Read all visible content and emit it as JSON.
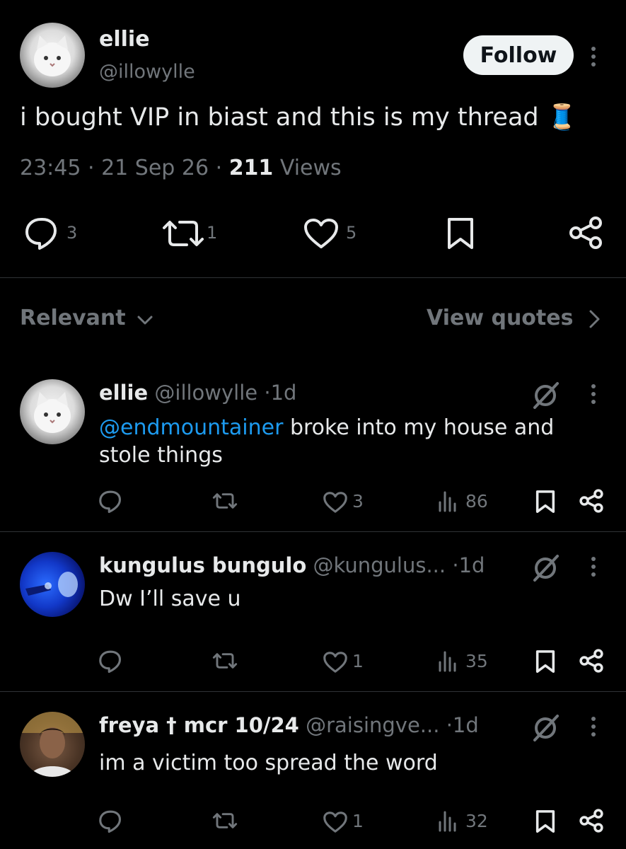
{
  "main_post": {
    "author_name": "ellie",
    "author_handle": "@illowylle",
    "follow_label": "Follow",
    "text": "i bought VIP in biast and this is my thread 🧵",
    "time": "23:45",
    "date": "21 Sep 26",
    "views_count": "211",
    "views_label": "Views",
    "replies": "3",
    "reposts": "1",
    "likes": "5"
  },
  "sort_bar": {
    "sort_label": "Relevant",
    "quotes_label": "View quotes"
  },
  "replies": [
    {
      "author_name": "ellie",
      "author_handle": "@illowylle",
      "time": "1d",
      "mention": "@endmountainer",
      "text_line1": " broke into my house and",
      "text_line2": "stole things",
      "likes": "3",
      "views": "86"
    },
    {
      "author_name": "kungulus bungulo",
      "author_handle": "@kungulus...",
      "time": "1d",
      "text": "Dw I’ll save u",
      "likes": "1",
      "views": "35"
    },
    {
      "author_name": "freya † mcr 10/24",
      "author_handle": "@raisingve...",
      "time": "1d",
      "text": "im a victim too spread the word",
      "likes": "1",
      "views": "32"
    }
  ],
  "colors": {
    "background": "#000000",
    "text": "#e7e9ea",
    "muted": "#71767b",
    "link": "#1d9bf0",
    "divider": "#2f3336"
  }
}
